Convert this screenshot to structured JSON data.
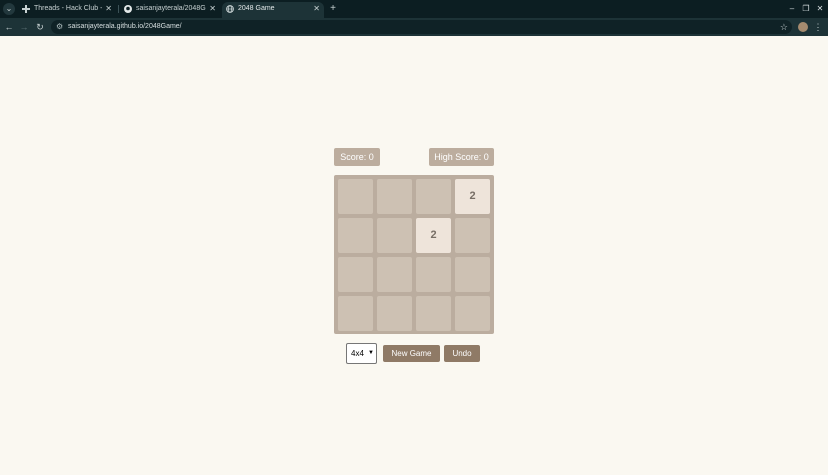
{
  "browser": {
    "tabs": [
      {
        "title": "Threads - Hack Club - Sla",
        "favicon": "slack-icon"
      },
      {
        "title": "saisanjayterala/2048Gam",
        "favicon": "github-icon"
      },
      {
        "title": "2048 Game",
        "favicon": "globe-icon",
        "active": true
      }
    ],
    "new_tab_label": "+",
    "url": "saisanjayterala.github.io/2048Game/"
  },
  "game": {
    "score_label": "Score: 0",
    "high_score_label": "High Score: 0",
    "grid_size": "4x4",
    "board": [
      [
        "",
        "",
        "",
        "2"
      ],
      [
        "",
        "",
        "2",
        ""
      ],
      [
        "",
        "",
        "",
        ""
      ],
      [
        "",
        "",
        "",
        ""
      ]
    ],
    "new_game_label": "New Game",
    "undo_label": "Undo"
  },
  "colors": {
    "page_background": "#faf8f1",
    "board_background": "#bbad9f",
    "empty_cell": "#cdc1b3",
    "tile_2": "#eee4da",
    "button": "#8f7a66"
  }
}
